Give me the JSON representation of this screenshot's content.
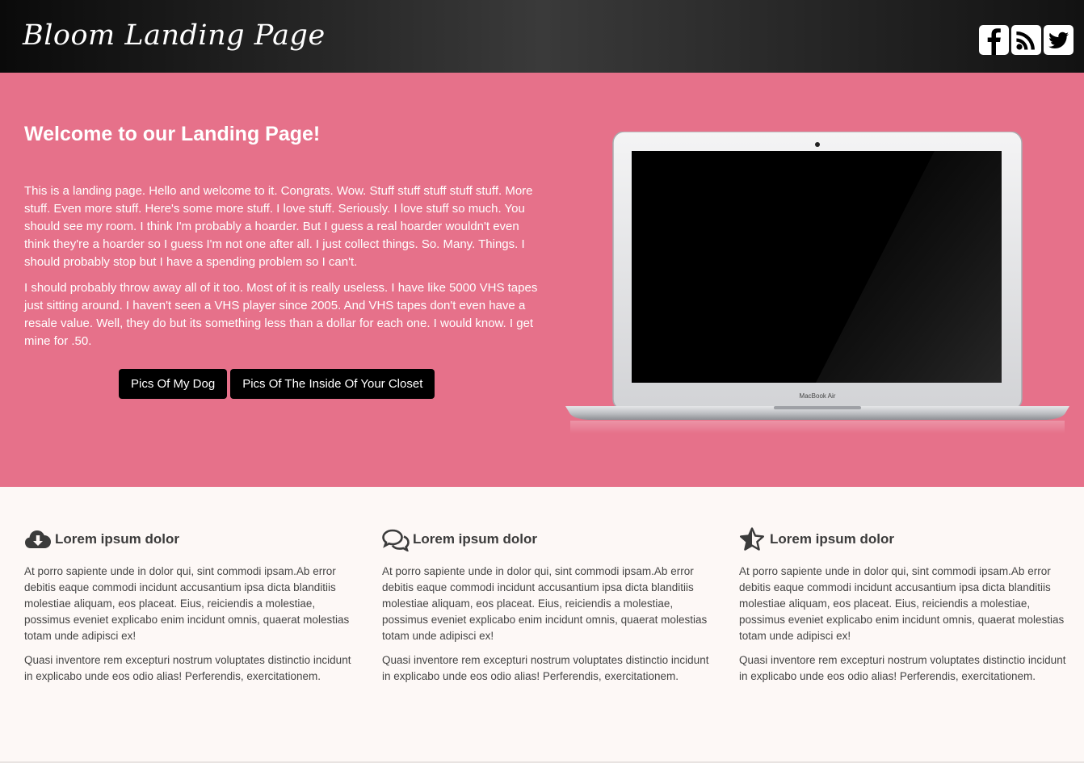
{
  "header": {
    "brand": "Bloom Landing Page",
    "social": [
      {
        "name": "facebook-icon"
      },
      {
        "name": "rss-icon"
      },
      {
        "name": "twitter-icon"
      }
    ]
  },
  "hero": {
    "title": "Welcome to our Landing Page!",
    "paragraphs": [
      "This is a landing page. Hello and welcome to it. Congrats. Wow. Stuff stuff stuff stuff stuff. More stuff. Even more stuff. Here's some more stuff. I love stuff. Seriously. I love stuff so much. You should see my room. I think I'm probably a hoarder. But I guess a real hoarder wouldn't even think they're a hoarder so I guess I'm not one after all. I just collect things. So. Many. Things. I should probably stop but I have a spending problem so I can't.",
      "I should probably throw away all of it too. Most of it is really useless. I have like 5000 VHS tapes just sitting around. I haven't seen a VHS player since 2005. And VHS tapes don't even have a resale value. Well, they do but its something less than a dollar for each one. I would know. I get mine for .50."
    ],
    "buttons": [
      "Pics Of My Dog",
      "Pics Of The Inside Of Your Closet"
    ],
    "laptop_label": "MacBook Air"
  },
  "features": [
    {
      "icon": "cloud-download-icon",
      "title": "Lorem ipsum dolor",
      "p1": "At porro sapiente unde in dolor qui, sint commodi ipsam.Ab error debitis eaque commodi incidunt accusantium ipsa dicta blanditiis molestiae aliquam, eos placeat. Eius, reiciendis a molestiae, possimus eveniet explicabo enim incidunt omnis, quaerat molestias totam unde adipisci ex!",
      "p2": "Quasi inventore rem excepturi nostrum voluptates distinctio incidunt in explicabo unde eos odio alias! Perferendis, exercitationem."
    },
    {
      "icon": "comments-icon",
      "title": "Lorem ipsum dolor",
      "p1": "At porro sapiente unde in dolor qui, sint commodi ipsam.Ab error debitis eaque commodi incidunt accusantium ipsa dicta blanditiis molestiae aliquam, eos placeat. Eius, reiciendis a molestiae, possimus eveniet explicabo enim incidunt omnis, quaerat molestias totam unde adipisci ex!",
      "p2": "Quasi inventore rem excepturi nostrum voluptates distinctio incidunt in explicabo unde eos odio alias! Perferendis, exercitationem."
    },
    {
      "icon": "star-half-icon",
      "title": "Lorem ipsum dolor",
      "p1": "At porro sapiente unde in dolor qui, sint commodi ipsam.Ab error debitis eaque commodi incidunt accusantium ipsa dicta blanditiis molestiae aliquam, eos placeat. Eius, reiciendis a molestiae, possimus eveniet explicabo enim incidunt omnis, quaerat molestias totam unde adipisci ex!",
      "p2": "Quasi inventore rem excepturi nostrum voluptates distinctio incidunt in explicabo unde eos odio alias! Perferendis, exercitationem."
    }
  ],
  "colors": {
    "hero_bg": "#e6718a",
    "button_bg": "#000000",
    "header_bg": "#1e1e1e",
    "features_bg": "#fdf8f6"
  }
}
